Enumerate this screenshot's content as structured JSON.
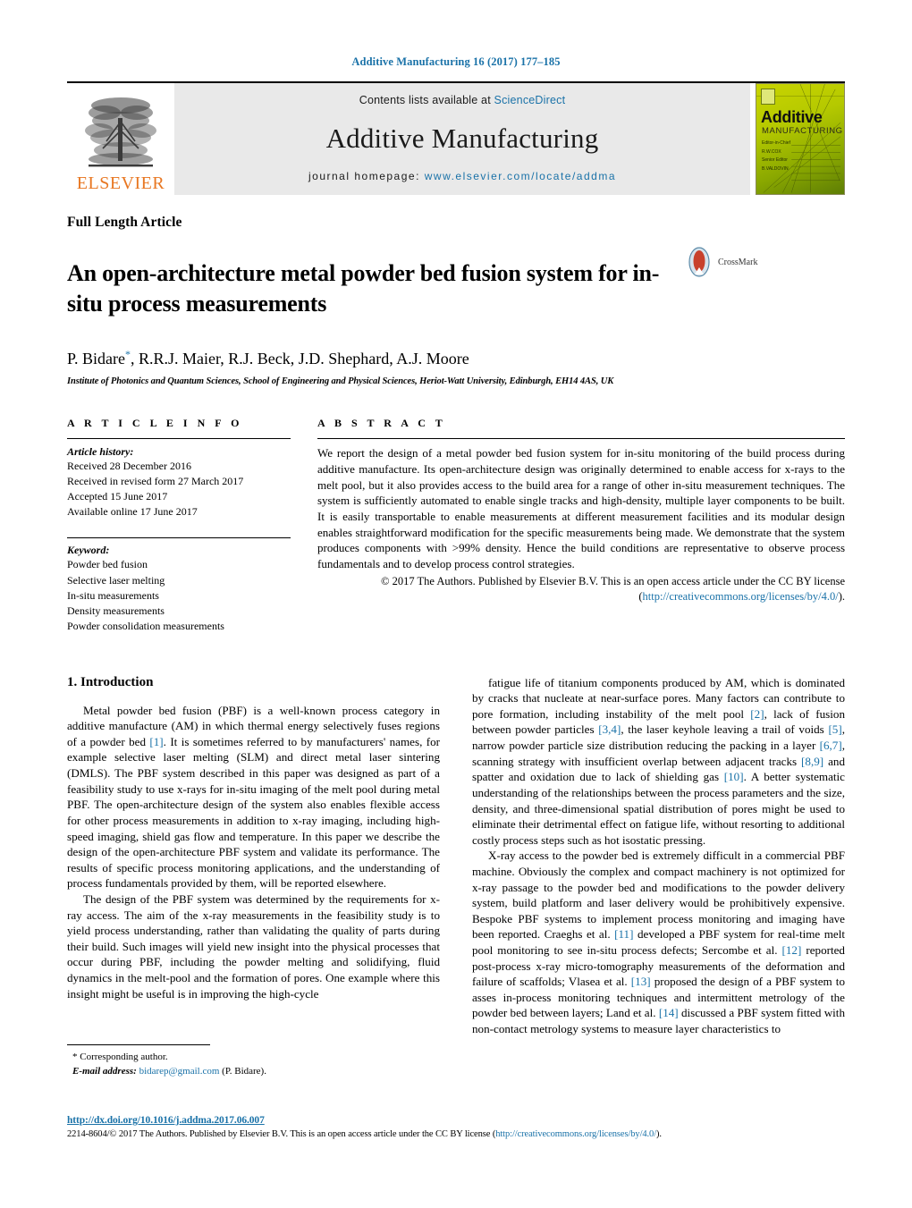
{
  "running_head": "Additive Manufacturing 16 (2017) 177–185",
  "masthead": {
    "contents_prefix": "Contents lists available at ",
    "contents_link": "ScienceDirect",
    "journal_name": "Additive Manufacturing",
    "homepage_prefix": "journal homepage: ",
    "homepage_link": "www.elsevier.com/locate/addma",
    "publisher_wordmark": "ELSEVIER",
    "cover": {
      "title": "Additive",
      "subtitle": "MANUFACTURING",
      "meta_line1": "Editor-in-Chief",
      "meta_line2": "R.W.COX",
      "meta_line3": "Senior Editor",
      "meta_line4": "B.VALDOVIN"
    }
  },
  "article_type": "Full Length Article",
  "title": "An open-architecture metal powder bed fusion system for in-situ process measurements",
  "crossmark_label": "CrossMark",
  "authors": "P. Bidare",
  "authors_rest": ", R.R.J. Maier, R.J. Beck, J.D. Shephard, A.J. Moore",
  "author_star": "*",
  "affiliation": "Institute of Photonics and Quantum Sciences, School of Engineering and Physical Sciences, Heriot-Watt University, Edinburgh, EH14 4AS, UK",
  "article_info": {
    "heading": "A R T I C L E   I N F O",
    "history_label": "Article history:",
    "history": [
      "Received 28 December 2016",
      "Received in revised form 27 March 2017",
      "Accepted 15 June 2017",
      "Available online 17 June 2017"
    ],
    "keyword_label": "Keyword:",
    "keywords": [
      "Powder bed fusion",
      "Selective laser melting",
      "In-situ measurements",
      "Density measurements",
      "Powder consolidation measurements"
    ]
  },
  "abstract": {
    "heading": "A B S T R A C T",
    "text": "We report the design of a metal powder bed fusion system for in-situ monitoring of the build process during additive manufacture. Its open-architecture design was originally determined to enable access for x-rays to the melt pool, but it also provides access to the build area for a range of other in-situ measurement techniques. The system is sufficiently automated to enable single tracks and high-density, multiple layer components to be built. It is easily transportable to enable measurements at different measurement facilities and its modular design enables straightforward modification for the specific measurements being made. We demonstrate that the system produces components with >99% density. Hence the build conditions are representative to observe process fundamentals and to develop process control strategies.",
    "copyright": "© 2017 The Authors. Published by Elsevier B.V. This is an open access article under the CC BY license",
    "license_open": "(",
    "license_link": "http://creativecommons.org/licenses/by/4.0/",
    "license_close": ")."
  },
  "body": {
    "section_number_title": "1.  Introduction",
    "left_paragraphs": [
      {
        "segments": [
          {
            "t": "Metal powder bed fusion (PBF) is a well-known process category in additive manufacture (AM) in which thermal energy selectively fuses regions of a powder bed ",
            "link": false
          },
          {
            "t": "[1]",
            "link": true
          },
          {
            "t": ". It is sometimes referred to by manufacturers' names, for example selective laser melting (SLM) and direct metal laser sintering (DMLS). The PBF system described in this paper was designed as part of a feasibility study to use x-rays for in-situ imaging of the melt pool during metal PBF. The open-architecture design of the system also enables flexible access for other process measurements in addition to x-ray imaging, including high-speed imaging, shield gas flow and temperature. In this paper we describe the design of the open-architecture PBF system and validate its performance. The results of specific process monitoring applications, and the understanding of process fundamentals provided by them, will be reported elsewhere.",
            "link": false
          }
        ]
      },
      {
        "segments": [
          {
            "t": "The design of the PBF system was determined by the requirements for x-ray access. The aim of the x-ray measurements in the feasibility study is to yield process understanding, rather than validating the quality of parts during their build. Such images will yield new insight into the physical processes that occur during PBF, including the powder melting and solidifying, fluid dynamics in the melt-pool and the formation of pores. One example where this insight might be useful is in improving the high-cycle",
            "link": false
          }
        ]
      }
    ],
    "right_paragraphs": [
      {
        "segments": [
          {
            "t": "fatigue life of titanium components produced by AM, which is dominated by cracks that nucleate at near-surface pores. Many factors can contribute to pore formation, including instability of the melt pool ",
            "link": false
          },
          {
            "t": "[2]",
            "link": true
          },
          {
            "t": ", lack of fusion between powder particles ",
            "link": false
          },
          {
            "t": "[3,4]",
            "link": true
          },
          {
            "t": ", the laser keyhole leaving a trail of voids ",
            "link": false
          },
          {
            "t": "[5]",
            "link": true
          },
          {
            "t": ", narrow powder particle size distribution reducing the packing in a layer ",
            "link": false
          },
          {
            "t": "[6,7]",
            "link": true
          },
          {
            "t": ", scanning strategy with insufficient overlap between adjacent tracks ",
            "link": false
          },
          {
            "t": "[8,9]",
            "link": true
          },
          {
            "t": " and spatter and oxidation due to lack of shielding gas ",
            "link": false
          },
          {
            "t": "[10]",
            "link": true
          },
          {
            "t": ". A better systematic understanding of the relationships between the process parameters and the size, density, and three-dimensional spatial distribution of pores might be used to eliminate their detrimental effect on fatigue life, without resorting to additional costly process steps such as hot isostatic pressing.",
            "link": false
          }
        ]
      },
      {
        "segments": [
          {
            "t": "X-ray access to the powder bed is extremely difficult in a commercial PBF machine. Obviously the complex and compact machinery is not optimized for x-ray passage to the powder bed and modifications to the powder delivery system, build platform and laser delivery would be prohibitively expensive. Bespoke PBF systems to implement process monitoring and imaging have been reported. Craeghs et al. ",
            "link": false
          },
          {
            "t": "[11]",
            "link": true
          },
          {
            "t": " developed a PBF system for real-time melt pool monitoring to see in-situ process defects; Sercombe et al. ",
            "link": false
          },
          {
            "t": "[12]",
            "link": true
          },
          {
            "t": " reported post-process x-ray micro-tomography measurements of the deformation and failure of scaffolds; Vlasea et al. ",
            "link": false
          },
          {
            "t": "[13]",
            "link": true
          },
          {
            "t": " proposed the design of a PBF system to asses in-process monitoring techniques and intermittent metrology of the powder bed between layers; Land et al. ",
            "link": false
          },
          {
            "t": "[14]",
            "link": true
          },
          {
            "t": " discussed a PBF system fitted with non-contact metrology systems to measure layer characteristics to",
            "link": false
          }
        ]
      }
    ]
  },
  "footer": {
    "corresponding_author": "* Corresponding author.",
    "email_label": "E-mail address:",
    "email": "bidarep@gmail.com",
    "email_suffix": " (P. Bidare).",
    "doi": "http://dx.doi.org/10.1016/j.addma.2017.06.007",
    "issn_prefix": "2214-8604/© 2017 The Authors. Published by Elsevier B.V. This is an open access article under the CC BY license (",
    "issn_link": "http://creativecommons.org/licenses/by/4.0/",
    "issn_suffix": ")."
  },
  "colors": {
    "link_blue": "#1a72a8",
    "elsevier_orange": "#e87722",
    "masthead_grey": "#e9e9e9"
  }
}
